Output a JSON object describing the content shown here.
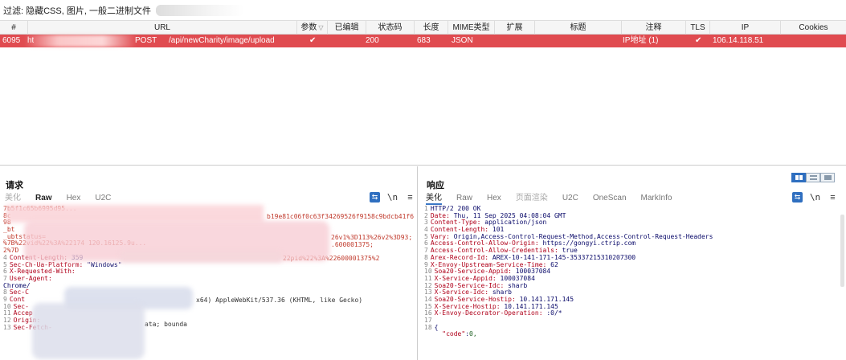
{
  "filter": {
    "text": "过滤: 隐藏CSS, 图片, 一般二进制文件"
  },
  "table": {
    "columns": [
      {
        "key": "num",
        "label": "#"
      },
      {
        "key": "url",
        "label": "URL"
      },
      {
        "key": "params",
        "label": "参数"
      },
      {
        "key": "edited",
        "label": "已编辑"
      },
      {
        "key": "status",
        "label": "状态码"
      },
      {
        "key": "length",
        "label": "长度"
      },
      {
        "key": "mime",
        "label": "MIME类型"
      },
      {
        "key": "ext",
        "label": "扩展"
      },
      {
        "key": "title",
        "label": "标题"
      },
      {
        "key": "comment",
        "label": "注释"
      },
      {
        "key": "tls",
        "label": "TLS"
      },
      {
        "key": "ip",
        "label": "IP"
      },
      {
        "key": "cookies",
        "label": "Cookies"
      }
    ],
    "selected_row": {
      "num": "6095",
      "host_prefix": "ht",
      "method": "POST",
      "url": "/api/newCharity/image/upload",
      "params": "✔",
      "status": "200",
      "length": "683",
      "mime": "JSON",
      "comment": "IP地址 (1)",
      "tls": "✔",
      "ip": "106.14.118.51"
    }
  },
  "request": {
    "title": "请求",
    "tabs": [
      "美化",
      "Raw",
      "Hex",
      "U2C"
    ],
    "active_tab": "Raw",
    "lines": [
      {
        "n": "",
        "text": "7b5f1c65b6995d95..."
      },
      {
        "n": "",
        "text": "8c"
      },
      {
        "n": "",
        "text": "98"
      },
      {
        "n": "",
        "text": "_bt"
      },
      {
        "n": "",
        "text": "_ubtstatus="
      },
      {
        "n": "",
        "text": "%7B%22vid%22%3A%22174 120.16125.9u..."
      },
      {
        "n": "",
        "text": "2%7D"
      },
      {
        "n": "4",
        "k": "Content-Length",
        "v": "359"
      },
      {
        "n": "5",
        "k": "Sec-Ch-Ua-Platform",
        "v": "\"Windows\""
      },
      {
        "n": "6",
        "k": "X-Requested-With",
        "v": ""
      },
      {
        "n": "7",
        "k": "User-Agent",
        "v": ""
      },
      {
        "n": "",
        "text": "Chrome/"
      },
      {
        "n": "8",
        "k": "Sec-C",
        "v": ""
      },
      {
        "n": "9",
        "k": "Cont",
        "v": ""
      },
      {
        "n": "10",
        "k": "Sec-",
        "v": ""
      },
      {
        "n": "11",
        "k": "Accep",
        "v": ""
      },
      {
        "n": "12",
        "k": "Origin",
        "v": ""
      },
      {
        "n": "13",
        "k": "Sec-Fetch-",
        "v": ""
      }
    ],
    "fragments": {
      "frag1": "b19e81c06f0c63f34269526f9158c9bdcb41f6",
      "frag2": "26v1%3D113%26v2%3D93;",
      "frag3": ".600001375;",
      "frag4": "22pid%22%3A%22600001375%2",
      "frag5": "x64) AppleWebKit/537.36 (KHTML, like Gecko)",
      "frag6": "ata; bounda"
    }
  },
  "response": {
    "title": "响应",
    "tabs": [
      "美化",
      "Raw",
      "Hex",
      "页面渲染",
      "U2C",
      "OneScan",
      "MarkInfo"
    ],
    "active_tab": "美化",
    "lines": [
      {
        "n": "1",
        "text": "HTTP/2 200 OK"
      },
      {
        "n": "2",
        "k": "Date",
        "v": "Thu, 11 Sep 2025 04:08:04 GMT"
      },
      {
        "n": "3",
        "k": "Content-Type",
        "v": "application/json"
      },
      {
        "n": "4",
        "k": "Content-Length",
        "v": "101"
      },
      {
        "n": "5",
        "k": "Vary",
        "v": "Origin,Access-Control-Request-Method,Access-Control-Request-Headers"
      },
      {
        "n": "6",
        "k": "Access-Control-Allow-Origin",
        "v": "https://gongyi.ctrip.com"
      },
      {
        "n": "7",
        "k": "Access-Control-Allow-Credentials",
        "v": "true"
      },
      {
        "n": "8",
        "k": "Arex-Record-Id",
        "v": "AREX-10-141-171-145-35337215310207300"
      },
      {
        "n": "9",
        "k": "X-Envoy-Upstream-Service-Time",
        "v": "62"
      },
      {
        "n": "10",
        "k": "Soa20-Service-Appid",
        "v": "100037084"
      },
      {
        "n": "11",
        "k": "X-Service-Appid",
        "v": "100037084"
      },
      {
        "n": "12",
        "k": "Soa20-Service-Idc",
        "v": "sharb"
      },
      {
        "n": "13",
        "k": "X-Service-Idc",
        "v": "sharb"
      },
      {
        "n": "14",
        "k": "Soa20-Service-Hostip",
        "v": "10.141.171.145"
      },
      {
        "n": "15",
        "k": "X-Service-Hostip",
        "v": "10.141.171.145"
      },
      {
        "n": "16",
        "k": "X-Envoy-Decorator-Operation",
        "v": ":0/*"
      },
      {
        "n": "17",
        "text": ""
      },
      {
        "n": "18",
        "text": "{"
      },
      {
        "n": "",
        "jk": "\"code\"",
        "jv": "0,"
      }
    ]
  },
  "toolbar": {
    "wrap_icon": "⇆",
    "ln_icon": "\\n",
    "menu_icon": "≡"
  },
  "colors": {
    "selected_row": "#e04b50",
    "accent": "#2f6fc0",
    "header_key": "#b0001a"
  }
}
